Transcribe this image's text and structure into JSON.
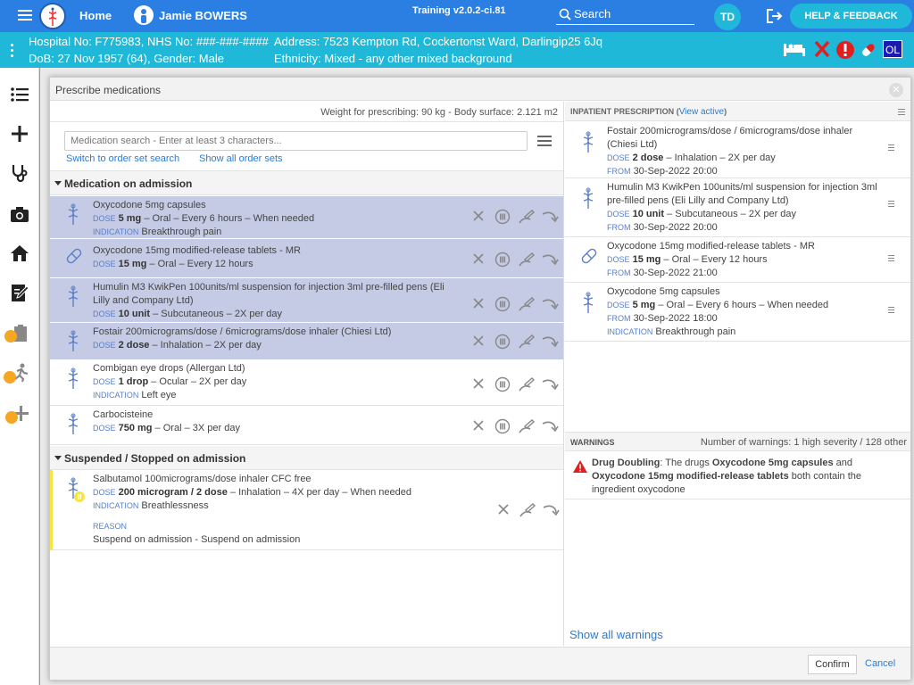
{
  "topbar": {
    "home": "Home",
    "user_name": "Jamie BOWERS",
    "training": "Training v2.0.2-ci.81",
    "search_label": "Search",
    "avatar_initials": "TD",
    "help": "HELP & FEEDBACK"
  },
  "patient": {
    "line1_left": "Hospital No: F775983, NHS No: ###-###-####",
    "line1_right": "Address: 7523 Kempton Rd, Cockertonst Ward, Darlingip25 6Jq",
    "line2_left": "DoB: 27 Nov 1957 (64), Gender: Male",
    "line2_right": "Ethnicity: Mixed - any other mixed background",
    "badge": "OL"
  },
  "modal": {
    "title": "Prescribe medications",
    "weight": "Weight for prescribing: 90 kg - Body surface: 2.121 m2",
    "search_placeholder": "Medication search - Enter at least 3 characters...",
    "link_order_set": "Switch to order set search",
    "link_show_all": "Show all order sets",
    "section_admission": "Medication on admission",
    "section_suspended": "Suspended / Stopped on admission",
    "confirm": "Confirm",
    "cancel": "Cancel"
  },
  "admission_meds": [
    {
      "name": "Oxycodone 5mg capsules",
      "dose_lbl": "DOSE",
      "dose": "5 mg",
      "dose_rest": " – Oral – Every 6 hours – When needed",
      "ind_lbl": "INDICATION",
      "indication": "Breakthrough pain"
    },
    {
      "name": "Oxycodone 15mg modified-release tablets - MR",
      "dose_lbl": "DOSE",
      "dose": "15 mg",
      "dose_rest": " – Oral – Every 12 hours"
    },
    {
      "name": "Humulin M3 KwikPen 100units/ml suspension for injection 3ml pre-filled pens (Eli Lilly and Company Ltd)",
      "dose_lbl": "DOSE",
      "dose": "10 unit",
      "dose_rest": " – Subcutaneous – 2X per day"
    },
    {
      "name": "Fostair 200micrograms/dose / 6micrograms/dose inhaler (Chiesi Ltd)",
      "dose_lbl": "DOSE",
      "dose": "2 dose",
      "dose_rest": " – Inhalation – 2X per day"
    },
    {
      "name": "Combigan eye drops (Allergan Ltd)",
      "dose_lbl": "DOSE",
      "dose": "1 drop",
      "dose_rest": " – Ocular – 2X per day",
      "ind_lbl": "INDICATION",
      "indication": "Left eye"
    },
    {
      "name": "Carbocisteine",
      "dose_lbl": "DOSE",
      "dose": "750 mg",
      "dose_rest": " – Oral – 3X per day"
    }
  ],
  "suspended_meds": [
    {
      "name": "Salbutamol 100micrograms/dose inhaler CFC free",
      "dose_lbl": "DOSE",
      "dose": "200 microgram / 2 dose",
      "dose_rest": " – Inhalation – 4X per day – When needed",
      "ind_lbl": "INDICATION",
      "indication": "Breathlessness",
      "reason_lbl": "REASON",
      "reason": "Suspend on admission - Suspend on admission"
    }
  ],
  "inpatient": {
    "head": "INPATIENT PRESCRIPTION",
    "view_active": "View active",
    "items": [
      {
        "name": "Fostair 200micrograms/dose / 6micrograms/dose inhaler (Chiesi Ltd)",
        "dose_lbl": "DOSE",
        "dose": "2 dose",
        "dose_rest": " – Inhalation – 2X per day",
        "from_lbl": "FROM",
        "from": "30-Sep-2022 20:00"
      },
      {
        "name": "Humulin M3 KwikPen 100units/ml suspension for injection 3ml pre-filled pens (Eli Lilly and Company Ltd)",
        "dose_lbl": "DOSE",
        "dose": "10 unit",
        "dose_rest": " – Subcutaneous – 2X per day",
        "from_lbl": "FROM",
        "from": "30-Sep-2022 20:00"
      },
      {
        "name": "Oxycodone 15mg modified-release tablets - MR",
        "dose_lbl": "DOSE",
        "dose": "15 mg",
        "dose_rest": " – Oral – Every 12 hours",
        "from_lbl": "FROM",
        "from": "30-Sep-2022 21:00"
      },
      {
        "name": "Oxycodone 5mg capsules",
        "dose_lbl": "DOSE",
        "dose": "5 mg",
        "dose_rest": " – Oral – Every 6 hours – When needed",
        "from_lbl": "FROM",
        "from": "30-Sep-2022 18:00",
        "ind_lbl": "INDICATION",
        "indication": "Breakthrough pain"
      }
    ]
  },
  "warnings": {
    "head": "WARNINGS",
    "count": "Number of warnings: 1 high severity / 128 other",
    "item_title": "Drug Doubling",
    "item_p1": ": The drugs ",
    "item_drug1": "Oxycodone 5mg capsules",
    "item_p2": " and ",
    "item_drug2": "Oxycodone 15mg modified-release tablets",
    "item_p3": " both contain the ingredient oxycodone",
    "show_all": "Show all warnings"
  },
  "colors": {
    "topbar": "#2b7fe2",
    "patientbar": "#20b8d8",
    "highlight_row": "#c5cbe4",
    "link": "#2c7bd1",
    "warn_red": "#e02020"
  }
}
